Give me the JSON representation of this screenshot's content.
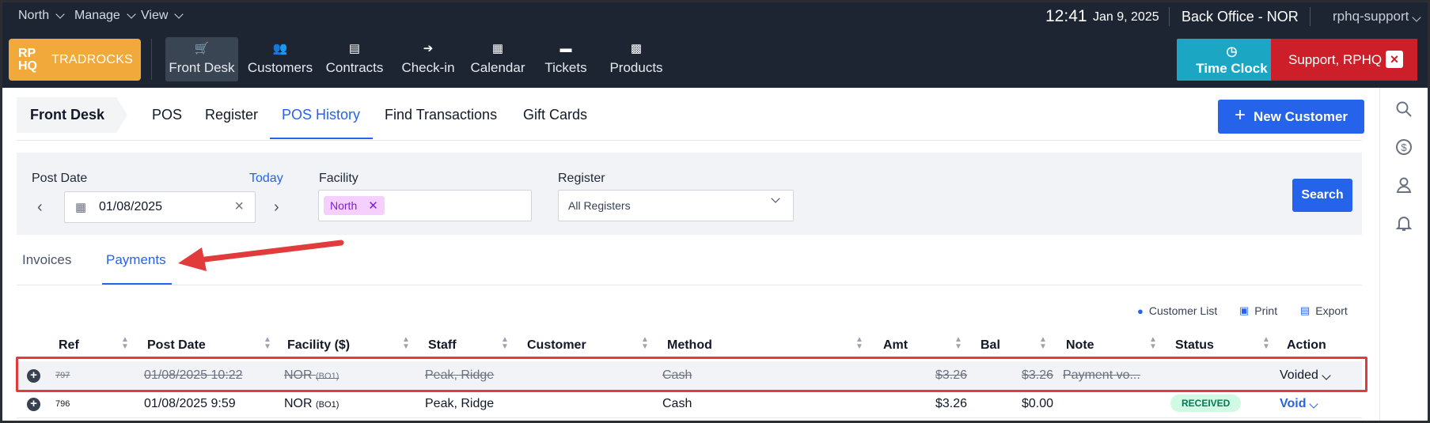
{
  "topbar": {
    "menus": [
      "North",
      "Manage",
      "View"
    ],
    "time": "12:41",
    "date": "Jan 9, 2025",
    "office": "Back Office - NOR",
    "user": "rphq-support"
  },
  "brand": {
    "logo": "RP HQ",
    "name": "TRADROCKS",
    "color": "#f2a93b"
  },
  "nav": {
    "items": [
      {
        "label": "Front Desk",
        "icon": "cart-icon"
      },
      {
        "label": "Customers",
        "icon": "users-icon"
      },
      {
        "label": "Contracts",
        "icon": "documents-icon"
      },
      {
        "label": "Check-in",
        "icon": "arrow-circle-icon"
      },
      {
        "label": "Calendar",
        "icon": "calendar-icon"
      },
      {
        "label": "Tickets",
        "icon": "chat-icon"
      },
      {
        "label": "Products",
        "icon": "boxes-icon"
      }
    ],
    "time_clock": "Time Clock",
    "support": "Support, RPHQ"
  },
  "subnav": {
    "crumb": "Front Desk",
    "tabs": [
      "POS",
      "Register",
      "POS History",
      "Find Transactions",
      "Gift Cards"
    ],
    "active": "POS History",
    "new_customer": "New Customer"
  },
  "filters": {
    "post_date_label": "Post Date",
    "today": "Today",
    "date_value": "01/08/2025",
    "facility_label": "Facility",
    "facility_chip": "North",
    "register_label": "Register",
    "register_value": "All Registers",
    "search": "Search"
  },
  "tabs": {
    "invoices": "Invoices",
    "payments": "Payments",
    "active": "Payments"
  },
  "toolbar": {
    "customer_list": "Customer List",
    "print": "Print",
    "export": "Export"
  },
  "table": {
    "headers": [
      "Ref",
      "Post Date",
      "Facility ($)",
      "Staff",
      "Customer",
      "Method",
      "Amt",
      "Bal",
      "Note",
      "Status",
      "Action"
    ],
    "rows": [
      {
        "ref": "797",
        "post_date": "01/08/2025 10:22",
        "facility": "NOR",
        "facility_code": "(BO1)",
        "staff": "Peak, Ridge",
        "customer": "",
        "method": "Cash",
        "amt": "$3.26",
        "bal": "$3.26",
        "note": "Payment vo...",
        "status": "",
        "action": "Voided"
      },
      {
        "ref": "796",
        "post_date": "01/08/2025 9:59",
        "facility": "NOR",
        "facility_code": "(BO1)",
        "staff": "Peak, Ridge",
        "customer": "",
        "method": "Cash",
        "amt": "$3.26",
        "bal": "$0.00",
        "note": "",
        "status": "RECEIVED",
        "action": "Void"
      }
    ]
  },
  "colors": {
    "accent": "#2563eb",
    "support": "#cc1f2a",
    "time_clock": "#1ba6c4",
    "annotation": "#e23b3b"
  }
}
